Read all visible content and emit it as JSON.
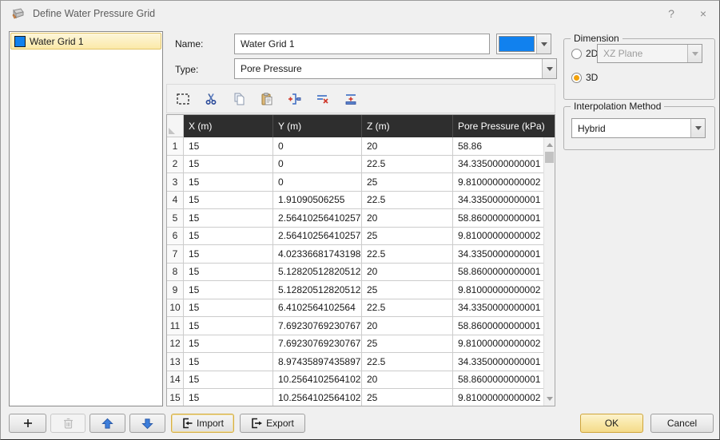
{
  "window": {
    "title": "Define Water Pressure Grid",
    "help_label": "?",
    "close_label": "×"
  },
  "accent": {
    "grid_color": "#1181ee",
    "selection_yellow": "#fbe9a8",
    "radio_orange": "#f2a20d"
  },
  "grid_list": {
    "items": [
      {
        "label": "Water Grid 1",
        "color": "#1181ee",
        "selected": true
      }
    ]
  },
  "form": {
    "name_label": "Name:",
    "name_value": "Water Grid 1",
    "color_value": "#1181ee",
    "type_label": "Type:",
    "type_value": "Pore Pressure"
  },
  "toolbar": {
    "icons": [
      "select-region-icon",
      "cut-icon",
      "copy-icon",
      "paste-icon",
      "insert-row-icon",
      "delete-row-icon",
      "append-row-icon"
    ]
  },
  "table": {
    "columns": [
      "X (m)",
      "Y (m)",
      "Z (m)",
      "Pore Pressure (kPa)"
    ],
    "rows": [
      {
        "num": "1",
        "x": "15",
        "y": "0",
        "z": "20",
        "p": "58.86"
      },
      {
        "num": "2",
        "x": "15",
        "y": "0",
        "z": "22.5",
        "p": "34.3350000000001"
      },
      {
        "num": "3",
        "x": "15",
        "y": "0",
        "z": "25",
        "p": "9.81000000000002"
      },
      {
        "num": "4",
        "x": "15",
        "y": "1.91090506255",
        "z": "22.5",
        "p": "34.3350000000001"
      },
      {
        "num": "5",
        "x": "15",
        "y": "2.56410256410257",
        "z": "20",
        "p": "58.8600000000001"
      },
      {
        "num": "6",
        "x": "15",
        "y": "2.56410256410257",
        "z": "25",
        "p": "9.81000000000002"
      },
      {
        "num": "7",
        "x": "15",
        "y": "4.02336681743198",
        "z": "22.5",
        "p": "34.3350000000001"
      },
      {
        "num": "8",
        "x": "15",
        "y": "5.12820512820512",
        "z": "20",
        "p": "58.8600000000001"
      },
      {
        "num": "9",
        "x": "15",
        "y": "5.12820512820512",
        "z": "25",
        "p": "9.81000000000002"
      },
      {
        "num": "10",
        "x": "15",
        "y": "6.4102564102564",
        "z": "22.5",
        "p": "34.3350000000001"
      },
      {
        "num": "11",
        "x": "15",
        "y": "7.69230769230767",
        "z": "20",
        "p": "58.8600000000001"
      },
      {
        "num": "12",
        "x": "15",
        "y": "7.69230769230767",
        "z": "25",
        "p": "9.81000000000002"
      },
      {
        "num": "13",
        "x": "15",
        "y": "8.97435897435897",
        "z": "22.5",
        "p": "34.3350000000001"
      },
      {
        "num": "14",
        "x": "15",
        "y": "10.2564102564102",
        "z": "20",
        "p": "58.8600000000001"
      },
      {
        "num": "15",
        "x": "15",
        "y": "10.2564102564102",
        "z": "25",
        "p": "9.81000000000002"
      }
    ]
  },
  "dimension": {
    "group_label": "Dimension",
    "radio_2d_label": "2D",
    "plane_value": "XZ Plane",
    "radio_3d_label": "3D",
    "selected": "3D"
  },
  "interpolation": {
    "group_label": "Interpolation Method",
    "value": "Hybrid"
  },
  "footer": {
    "import_label": "Import",
    "export_label": "Export",
    "ok_label": "OK",
    "cancel_label": "Cancel"
  }
}
